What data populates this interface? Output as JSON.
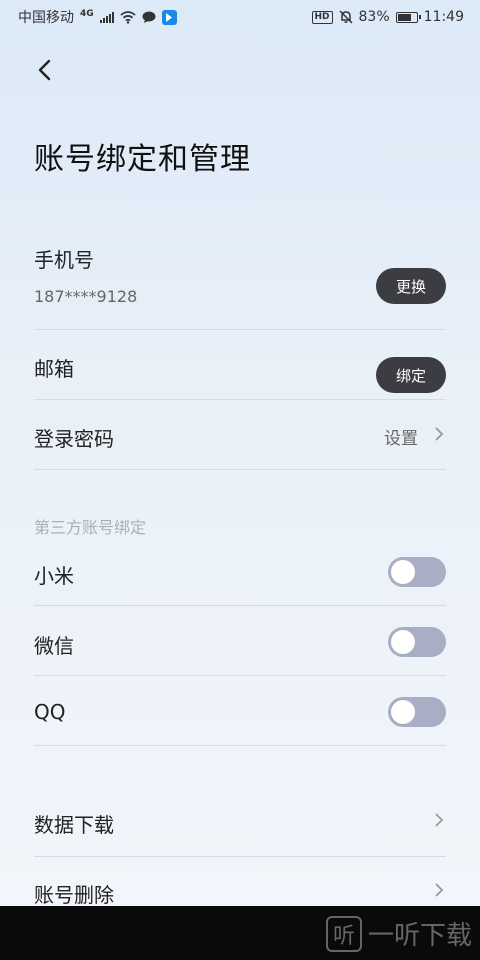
{
  "status_bar": {
    "carrier": "中国移动",
    "network": "4G",
    "hd": "HD",
    "battery": "83%",
    "battery_level": 0.83,
    "time": "11:49"
  },
  "page": {
    "title": "账号绑定和管理"
  },
  "phone": {
    "label": "手机号",
    "value": "187****9128",
    "button": "更换"
  },
  "email": {
    "label": "邮箱",
    "button": "绑定"
  },
  "password": {
    "label": "登录密码",
    "action": "设置"
  },
  "third_party": {
    "section_title": "第三方账号绑定",
    "items": [
      {
        "label": "小米",
        "enabled": false
      },
      {
        "label": "微信",
        "enabled": false
      },
      {
        "label": "QQ",
        "enabled": false
      }
    ]
  },
  "data_download": {
    "label": "数据下载"
  },
  "delete_account": {
    "label": "账号删除"
  },
  "watermark": {
    "text": "一听下载",
    "logo": "听"
  },
  "colors": {
    "button_bg": "#3b3d42",
    "toggle_off": "#a8aec3"
  }
}
